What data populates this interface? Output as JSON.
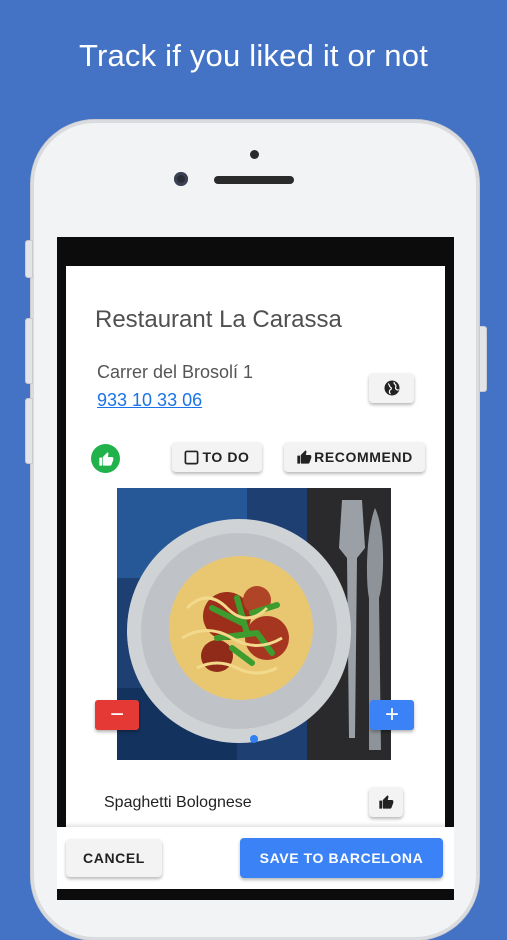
{
  "headline": "Track if you liked it or not",
  "restaurant": {
    "name": "Restaurant La Carassa",
    "address": "Carrer del Brosolí 1",
    "phone": "933 10 33 06"
  },
  "actions": {
    "todo_label": "TO DO",
    "recommend_label": "RECOMMEND"
  },
  "dish": {
    "name": "Spaghetti Bolognese",
    "minus_label": "−",
    "plus_label": "+"
  },
  "footer": {
    "cancel_label": "CANCEL",
    "save_label": "SAVE TO BARCELONA"
  },
  "icons": {
    "globe": "globe-icon",
    "liked": "thumbs-up-icon",
    "checkbox": "checkbox-empty-icon"
  },
  "colors": {
    "background": "#4472c4",
    "liked_green": "#22b24c",
    "primary_blue": "#3b82f6",
    "danger_red": "#e53935",
    "link_blue": "#1a73e8"
  }
}
